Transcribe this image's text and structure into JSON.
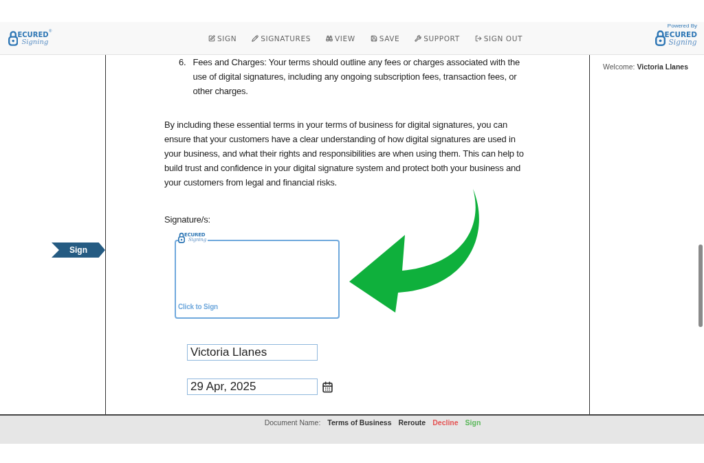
{
  "header": {
    "logo_left": {
      "mark": "ECURED",
      "script": "Signing",
      "registered": "®"
    },
    "nav": [
      {
        "label": "SIGN",
        "kind": "edit"
      },
      {
        "label": "SIGNATURES",
        "kind": "pencil"
      },
      {
        "label": "VIEW",
        "kind": "binoculars"
      },
      {
        "label": "SAVE",
        "kind": "save"
      },
      {
        "label": "SUPPORT",
        "kind": "wrench"
      },
      {
        "label": "SIGN OUT",
        "kind": "signout"
      }
    ],
    "logo_right": {
      "powered": "Powered By",
      "mark": "ECURED",
      "script": "Signing"
    }
  },
  "side_marker": {
    "label": "Sign"
  },
  "document": {
    "list_item": {
      "number": "6.",
      "text": "Fees and Charges: Your terms should outline any fees or charges associated with the use of digital signatures, including any ongoing subscription fees, transaction fees, or other charges."
    },
    "paragraph": "By including these essential terms in your terms of business for digital signatures, you can ensure that your customers have a clear understanding of how digital signatures are used in your business, and what their rights and responsibilities are when using them. This can help to build trust and confidence in your digital signature system and protect both your business and your customers from legal and financial risks.",
    "signature_label": "Signature/s:",
    "signature_box": {
      "logo": {
        "mark": "ECURED",
        "script": "Signing"
      },
      "prompt": "Click to Sign"
    },
    "name_field": {
      "value": "Victoria Llanes"
    },
    "date_field": {
      "value": "29 Apr, 2025"
    }
  },
  "sidebar": {
    "welcome_label": "Welcome:",
    "user": "Victoria Llanes"
  },
  "footer": {
    "document_label": "Document Name:",
    "document_name": "Terms of Business",
    "actions": [
      {
        "label": "Reroute",
        "kind": "reroute"
      },
      {
        "label": "Decline",
        "kind": "decline"
      },
      {
        "label": "Sign",
        "kind": "sign"
      }
    ]
  }
}
